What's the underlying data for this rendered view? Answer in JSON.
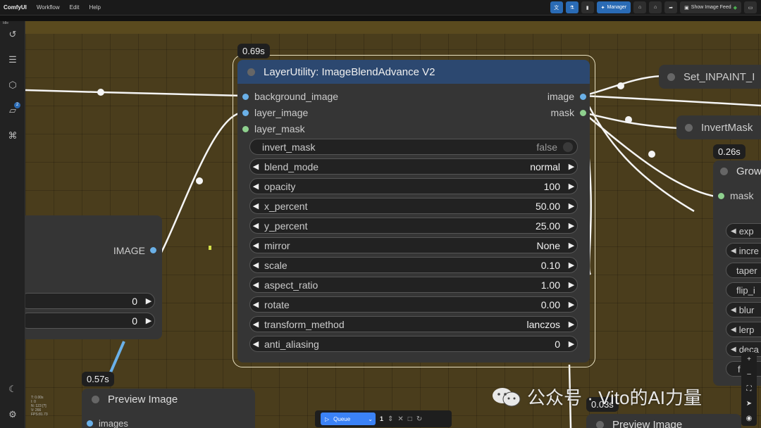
{
  "menubar": {
    "brand": "ComfyUI",
    "items": [
      "Workflow",
      "Edit",
      "Help"
    ],
    "manager_label": "Manager",
    "image_feed_label": "Show Image Feed"
  },
  "status": {
    "idle": "Idle"
  },
  "main_node": {
    "time": "0.69s",
    "title": "LayerUtility: ImageBlendAdvance V2",
    "inputs": [
      "background_image",
      "layer_image",
      "layer_mask"
    ],
    "outputs": [
      "image",
      "mask"
    ],
    "widgets": [
      {
        "name": "invert_mask",
        "value": "false",
        "kind": "toggle"
      },
      {
        "name": "blend_mode",
        "value": "normal",
        "kind": "combo"
      },
      {
        "name": "opacity",
        "value": "100",
        "kind": "number"
      },
      {
        "name": "x_percent",
        "value": "50.00",
        "kind": "number"
      },
      {
        "name": "y_percent",
        "value": "25.00",
        "kind": "number"
      },
      {
        "name": "mirror",
        "value": "None",
        "kind": "combo"
      },
      {
        "name": "scale",
        "value": "0.10",
        "kind": "number"
      },
      {
        "name": "aspect_ratio",
        "value": "1.00",
        "kind": "number"
      },
      {
        "name": "rotate",
        "value": "0.00",
        "kind": "number"
      },
      {
        "name": "transform_method",
        "value": "lanczos",
        "kind": "combo"
      },
      {
        "name": "anti_aliasing",
        "value": "0",
        "kind": "number"
      }
    ]
  },
  "left_node": {
    "output_label": "IMAGE",
    "widget_values": [
      "0",
      "0"
    ]
  },
  "right_nodes": {
    "set_inpaint": "Set_INPAINT_I",
    "invert_mask": "InvertMask",
    "grow_time": "0.26s",
    "grow_title": "Grow",
    "grow_input": "mask",
    "grow_widgets": [
      "exp",
      "incre",
      "taper",
      "flip_i",
      "blur",
      "lerp",
      "deca",
      "f"
    ]
  },
  "preview_left": {
    "time": "0.57s",
    "title": "Preview Image",
    "input": "images"
  },
  "preview_right": {
    "time": "0.03s",
    "title": "Preview Image"
  },
  "queue": {
    "label": "Queue",
    "count": "1"
  },
  "watermark": {
    "text": "公众号 · Vito的AI力量"
  },
  "stats": [
    "T: 0.00s",
    "I: 0",
    "N: 123 [?]",
    "V: 266",
    "FPS:81.73"
  ]
}
